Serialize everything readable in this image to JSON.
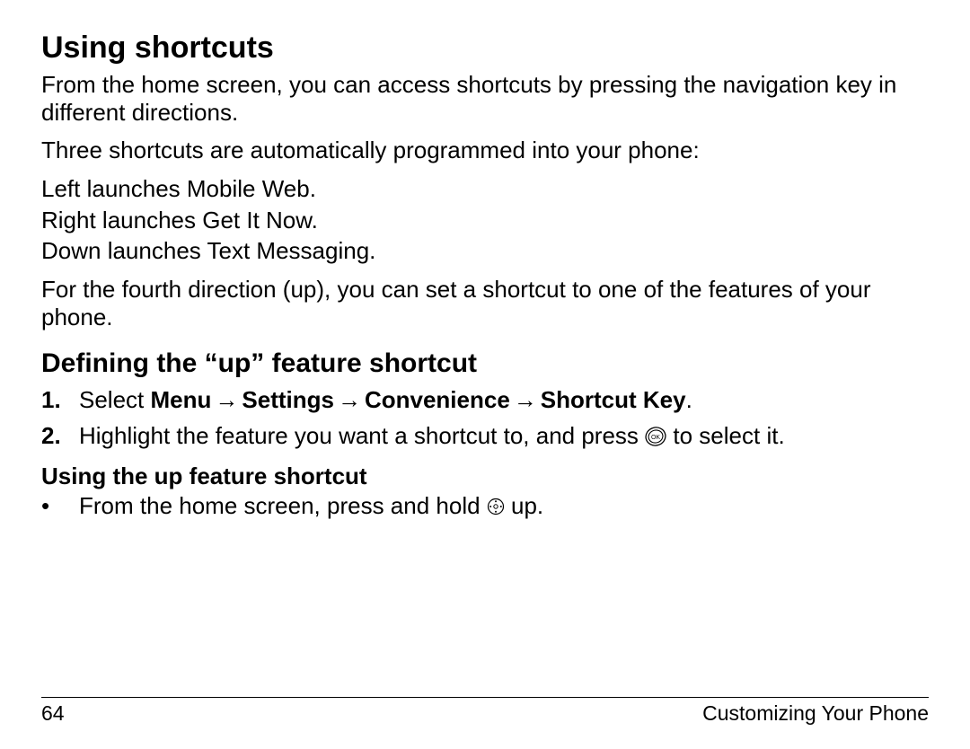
{
  "heading": "Using shortcuts",
  "intro1": "From the home screen, you can access shortcuts by pressing the navigation key in different directions.",
  "intro2": "Three shortcuts are automatically programmed into your phone:",
  "left_line": "Left launches Mobile Web.",
  "right_line": "Right launches Get It Now.",
  "down_line": "Down launches Text Messaging.",
  "fourth_line": "For the fourth direction (up), you can set a shortcut to one of the features of your phone.",
  "subheading": "Defining the “up” feature shortcut",
  "step1": {
    "num": "1.",
    "prefix": "Select ",
    "menu": "Menu",
    "settings": "Settings",
    "convenience": "Convenience",
    "shortcut_key": "Shortcut Key",
    "arrow": "→",
    "period": "."
  },
  "step2": {
    "num": "2.",
    "before": "Highlight the feature you want a shortcut to, and press ",
    "after": " to select it."
  },
  "minorheading": "Using the up feature shortcut",
  "bullet": {
    "dot": "•",
    "before": "From the home screen, press and hold ",
    "after": " up."
  },
  "footer": {
    "page_number": "64",
    "section": "Customizing Your Phone"
  }
}
